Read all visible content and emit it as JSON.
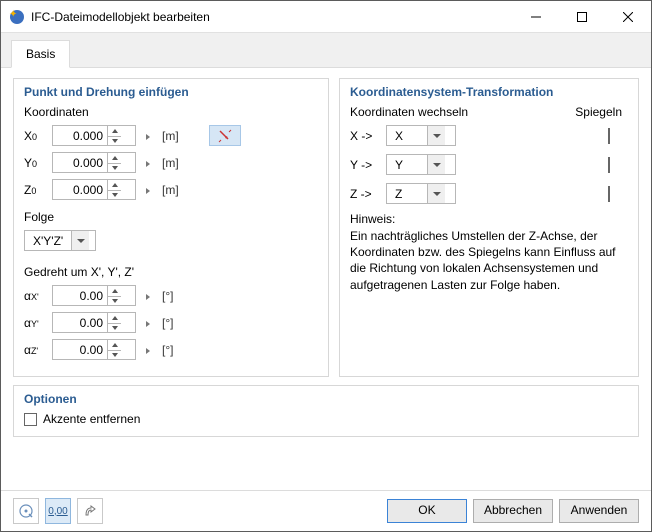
{
  "window": {
    "title": "IFC-Dateimodellobjekt bearbeiten"
  },
  "tabs": {
    "basis": "Basis"
  },
  "left": {
    "group_title": "Punkt und Drehung einfügen",
    "coord_label": "Koordinaten",
    "x": {
      "label": "X",
      "sub": "0",
      "value": "0.000",
      "unit": "[m]"
    },
    "y": {
      "label": "Y",
      "sub": "0",
      "value": "0.000",
      "unit": "[m]"
    },
    "z": {
      "label": "Z",
      "sub": "0",
      "value": "0.000",
      "unit": "[m]"
    },
    "sequence_label": "Folge",
    "sequence_value": "X'Y'Z'",
    "rot_label": "Gedreht um X', Y', Z'",
    "ax": {
      "label": "α",
      "sub": "X'",
      "value": "0.00",
      "unit": "[°]"
    },
    "ay": {
      "label": "α",
      "sub": "Y'",
      "value": "0.00",
      "unit": "[°]"
    },
    "az": {
      "label": "α",
      "sub": "Z'",
      "value": "0.00",
      "unit": "[°]"
    }
  },
  "right": {
    "group_title": "Koordinatensystem-Transformation",
    "swap_label": "Koordinaten wechseln",
    "mirror_label": "Spiegeln",
    "rowX": {
      "from": "X ->",
      "to": "X"
    },
    "rowY": {
      "from": "Y ->",
      "to": "Y"
    },
    "rowZ": {
      "from": "Z ->",
      "to": "Z"
    },
    "hint_label": "Hinweis:",
    "hint_text": "Ein nachträgliches Umstellen der Z-Achse, der Koordinaten bzw. des Spiegelns kann Einfluss auf die Richtung von lokalen Achsensystemen und aufgetragenen Lasten zur Folge haben."
  },
  "options": {
    "group_title": "Optionen",
    "remove_accents": "Akzente entfernen"
  },
  "footer": {
    "ok": "OK",
    "cancel": "Abbrechen",
    "apply": "Anwenden"
  }
}
